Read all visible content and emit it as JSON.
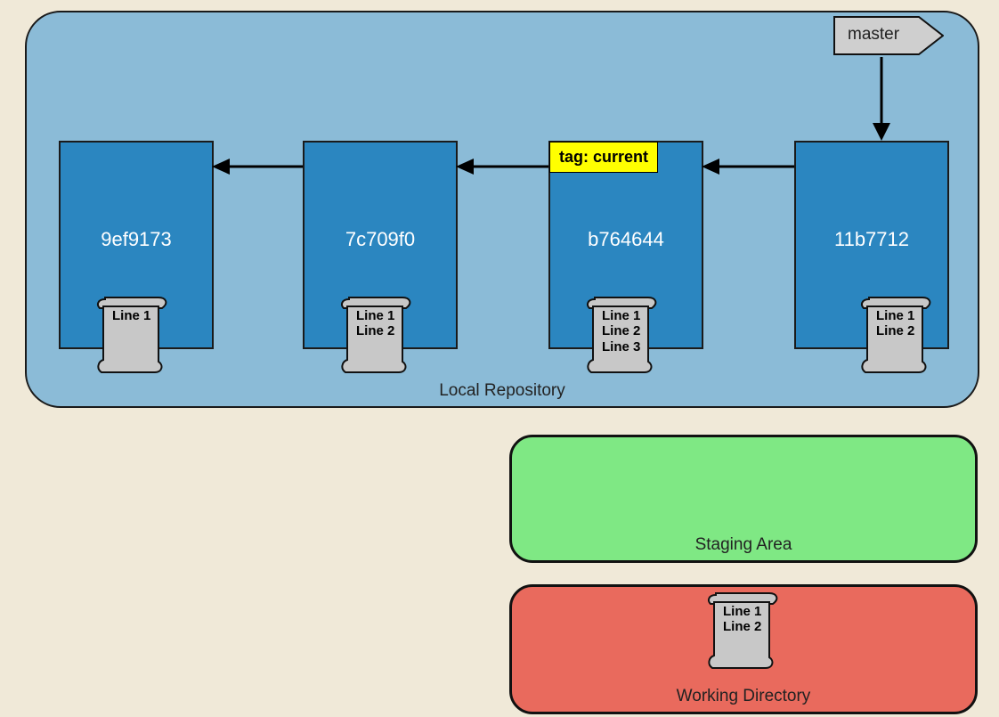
{
  "local_repo": {
    "label": "Local Repository",
    "commits": [
      {
        "hash": "9ef9173",
        "contents": [
          "Line 1"
        ]
      },
      {
        "hash": "7c709f0",
        "contents": [
          "Line 1",
          "Line 2"
        ]
      },
      {
        "hash": "b764644",
        "contents": [
          "Line 1",
          "Line 2",
          "Line 3"
        ],
        "tag": "tag: current"
      },
      {
        "hash": "11b7712",
        "contents": [
          "Line 1",
          "Line 2"
        ]
      }
    ],
    "branch": {
      "name": "master",
      "points_to": "11b7712"
    }
  },
  "staging_area": {
    "label": "Staging Area"
  },
  "working_directory": {
    "label": "Working Directory",
    "contents": [
      "Line 1",
      "Line 2"
    ]
  }
}
